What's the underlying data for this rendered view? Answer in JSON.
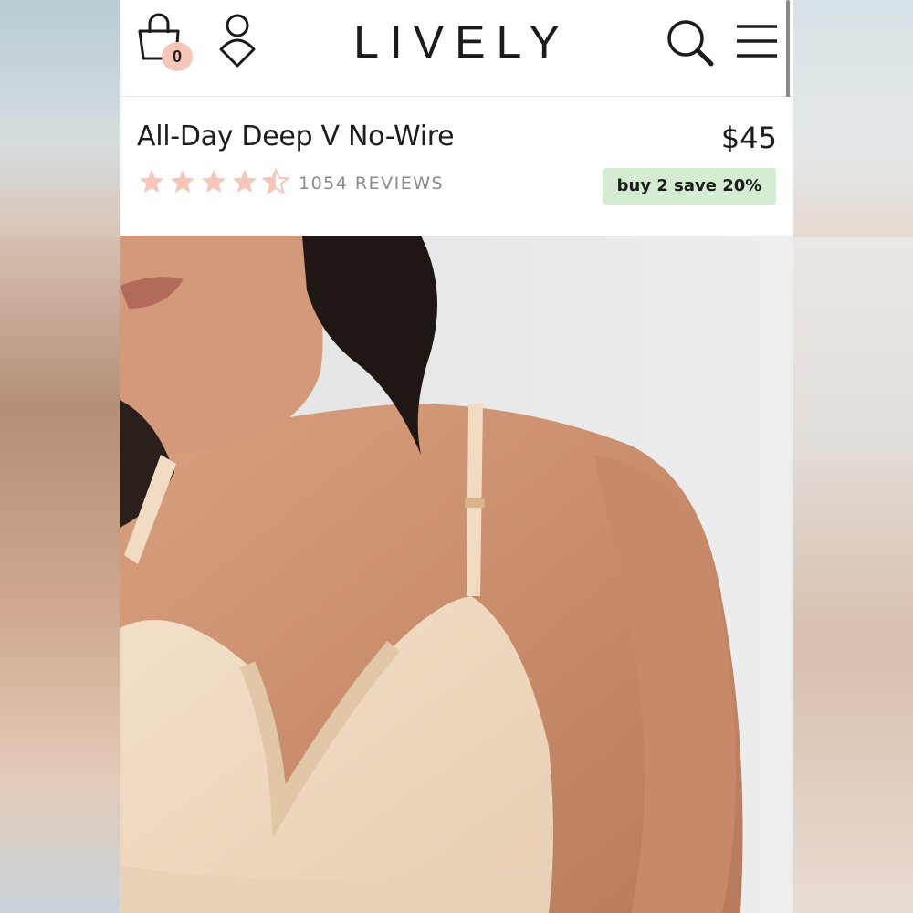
{
  "header": {
    "logo_text": "LIVELY",
    "cart_count": "0",
    "icons": [
      "shopping-bag-icon",
      "account-icon",
      "search-icon",
      "menu-icon"
    ]
  },
  "product": {
    "title": "All-Day Deep V No-Wire",
    "price": "$45",
    "rating": 4.5,
    "rating_max": 5,
    "reviews_label": "1054 REVIEWS",
    "promo": "buy 2 save 20%"
  },
  "image": {
    "subject": "product-photo"
  },
  "colors": {
    "star": "#f6c6b8",
    "badge_bg": "#f6c6b8",
    "promo_bg": "#d4ecd2",
    "text": "#1d1d1d",
    "muted": "#8b8b8b"
  }
}
